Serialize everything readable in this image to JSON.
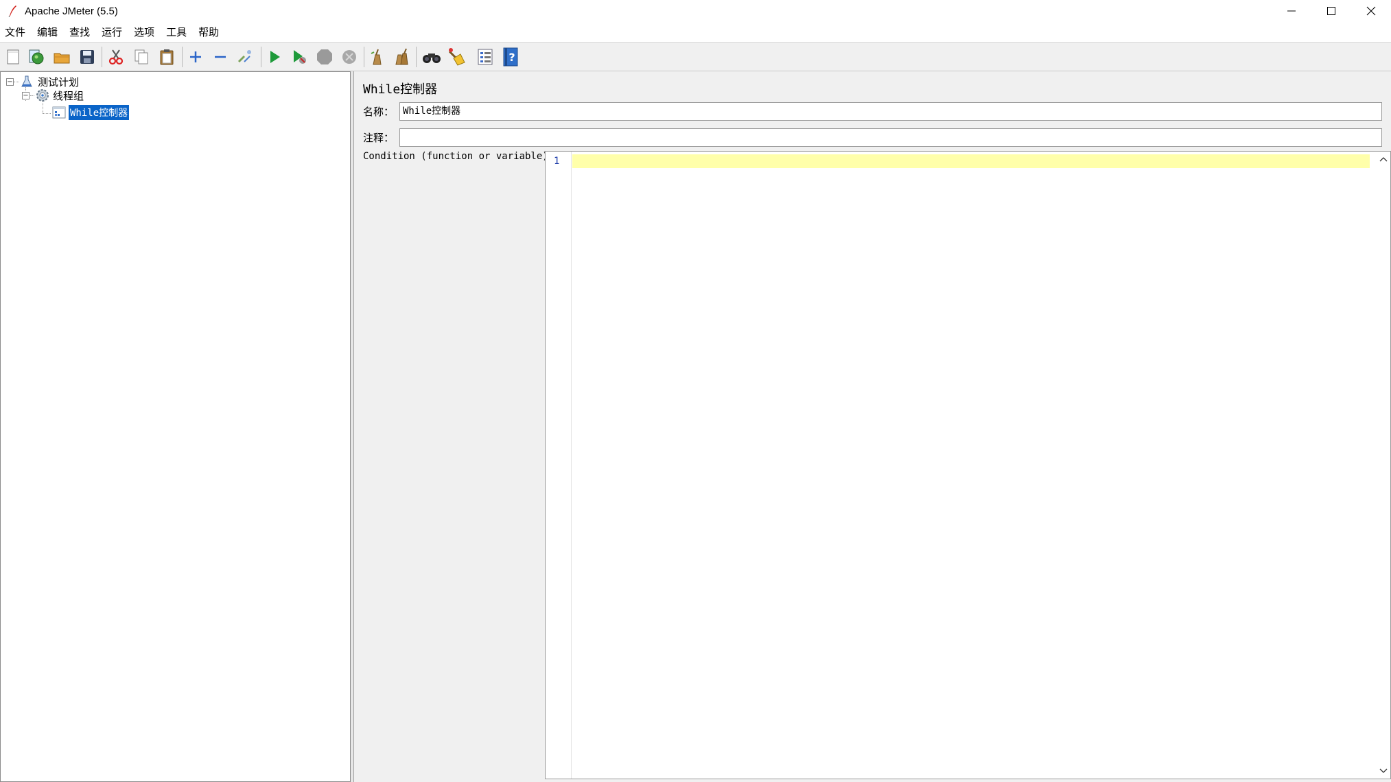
{
  "window": {
    "title": "Apache JMeter (5.5)",
    "controls": [
      "minimize",
      "maximize",
      "close"
    ]
  },
  "menubar": {
    "items": [
      "文件",
      "编辑",
      "查找",
      "运行",
      "选项",
      "工具",
      "帮助"
    ]
  },
  "toolbar": {
    "buttons": [
      "new-icon",
      "templates-icon",
      "open-icon",
      "save-icon",
      "cut-icon",
      "copy-icon",
      "paste-icon",
      "expand-icon",
      "collapse-icon",
      "toggle-icon",
      "start-icon",
      "start-no-pause-icon",
      "stop-icon",
      "shutdown-icon",
      "clear-icon",
      "clear-all-icon",
      "search-icon",
      "reset-search-icon",
      "function-helper-icon",
      "help-icon"
    ]
  },
  "tree": {
    "items": [
      {
        "label": "测试计划",
        "icon": "test-plan-icon",
        "expanded": true
      },
      {
        "label": "线程组",
        "icon": "thread-group-icon",
        "expanded": true
      },
      {
        "label": "While控制器",
        "icon": "while-controller-icon",
        "selected": true
      }
    ]
  },
  "panel": {
    "title": "While控制器",
    "name_label": "名称：",
    "name_value": "While控制器",
    "comment_label": "注释：",
    "comment_value": "",
    "condition_label": "Condition (function or variable)",
    "editor": {
      "line_numbers": [
        "1"
      ],
      "content": ""
    }
  },
  "colors": {
    "selection": "#0a64c8",
    "current_line": "#ffffaa",
    "background": "#f0f0f0"
  }
}
